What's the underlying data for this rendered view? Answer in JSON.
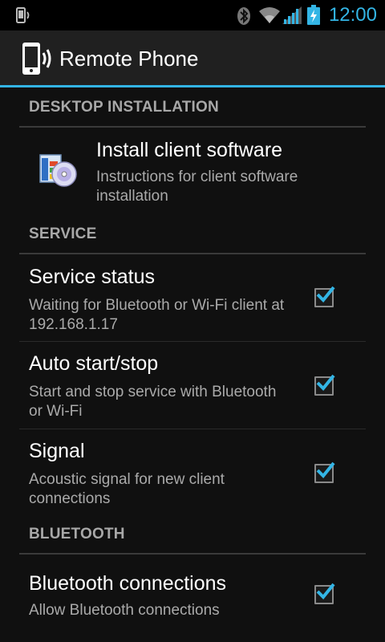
{
  "status_bar": {
    "time": "12:00",
    "icons": [
      "phone-vibrate-icon",
      "bluetooth-icon",
      "wifi-icon",
      "cell-signal-icon",
      "battery-charging-icon"
    ],
    "accent": "#33b5e5"
  },
  "action_bar": {
    "title": "Remote Phone",
    "icon": "phone-broadcast-icon"
  },
  "categories": {
    "desktop": "DESKTOP INSTALLATION",
    "service": "SERVICE",
    "bluetooth": "BLUETOOTH"
  },
  "prefs": {
    "install": {
      "title": "Install client software",
      "summary": "Instructions for client software installation",
      "icon": "software-install-icon"
    },
    "service_status": {
      "title": "Service status",
      "summary": "Waiting for Bluetooth or Wi-Fi client at 192.168.1.17",
      "checked": true
    },
    "auto_start": {
      "title": "Auto start/stop",
      "summary": "Start and stop service with Bluetooth or Wi-Fi",
      "checked": true
    },
    "signal": {
      "title": "Signal",
      "summary": "Acoustic signal for new client connections",
      "checked": true
    },
    "bt_connections": {
      "title": "Bluetooth connections",
      "summary": "Allow Bluetooth connections",
      "checked": true
    }
  }
}
